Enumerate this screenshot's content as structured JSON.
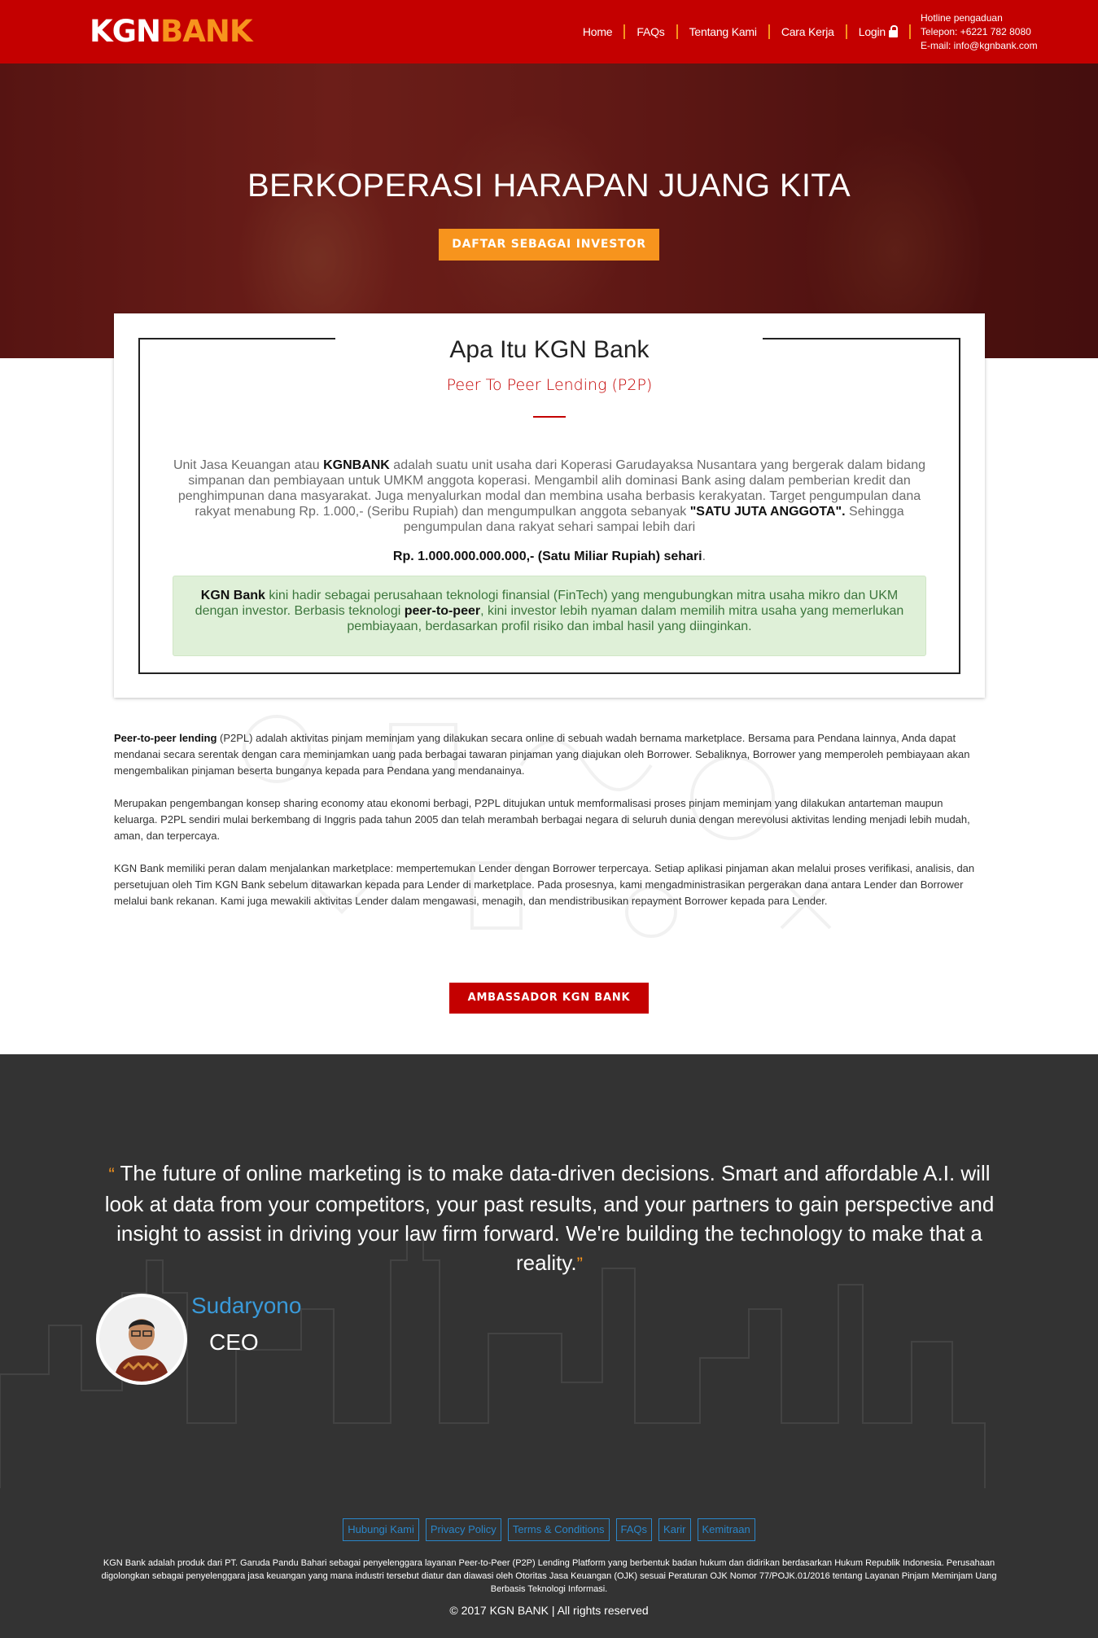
{
  "brand": {
    "logo_part1": "KGN",
    "logo_part2": "BANK"
  },
  "nav": {
    "items": [
      "Home",
      "FAQs",
      "Tentang Kami",
      "Cara Kerja",
      "Login"
    ]
  },
  "hotline": {
    "title": "Hotline pengaduan",
    "phone": "Telepon: +6221 782 8080",
    "email": "E-mail: info@kgnbank.com"
  },
  "hero": {
    "title": "BERKOPERASI HARAPAN JUANG KITA",
    "cta": "DAFTAR SEBAGAI INVESTOR"
  },
  "about": {
    "title": "Apa Itu KGN Bank",
    "subtitle": "Peer To Peer Lending (P2P)",
    "text_1": "Unit Jasa Keuangan atau ",
    "text_bold_1": "KGNBANK",
    "text_2": " adalah suatu unit usaha dari Koperasi Garudayaksa Nusantara yang bergerak dalam bidang simpanan dan pembiayaan untuk UMKM anggota koperasi. Mengambil alih dominasi Bank asing dalam pemberian kredit dan penghimpunan dana masyarakat. Juga menyalurkan modal dan membina usaha berbasis kerakyatan. Target pengumpulan dana rakyat menabung Rp. 1.000,- (Seribu Rupiah) dan mengumpulkan anggota sebanyak ",
    "text_bold_2": "\"SATU JUTA ANGGOTA\".",
    "text_3": " Sehingga pengumpulan dana rakyat sehari sampai lebih dari",
    "amount": "Rp. 1.000.000.000.000,- (Satu Miliar Rupiah) sehari",
    "amount_suffix": ".",
    "fintech_bold_1": "KGN Bank",
    "fintech_1": " kini hadir sebagai perusahaan teknologi finansial (FinTech) yang mengubungkan mitra usaha mikro dan UKM dengan investor. Berbasis teknologi ",
    "fintech_bold_2": "peer-to-peer",
    "fintech_2": ", kini investor lebih nyaman dalam memilih mitra usaha yang memerlukan pembiayaan, berdasarkan profil risiko dan imbal hasil yang diinginkan."
  },
  "body": {
    "p1_bold": "Peer-to-peer lending",
    "p1": " (P2PL) adalah aktivitas pinjam meminjam yang dilakukan secara online di sebuah wadah bernama marketplace. Bersama para Pendana lainnya, Anda dapat mendanai secara serentak dengan cara meminjamkan uang pada berbagai tawaran pinjaman yang diajukan oleh Borrower. Sebaliknya, Borrower yang memperoleh pembiayaan akan mengembalikan pinjaman beserta bunganya kepada para Pendana yang mendanainya.",
    "p2": "Merupakan pengembangan konsep sharing economy atau ekonomi berbagi, P2PL ditujukan untuk memformalisasi proses pinjam meminjam yang dilakukan antarteman maupun keluarga. P2PL sendiri mulai berkembang di Inggris pada tahun 2005 dan telah merambah berbagai negara di seluruh dunia dengan merevolusi aktivitas lending menjadi lebih mudah, aman, dan terpercaya.",
    "p3": "KGN Bank memiliki peran dalam menjalankan marketplace: mempertemukan Lender dengan Borrower terpercaya. Setiap aplikasi pinjaman akan melalui proses verifikasi, analisis, dan persetujuan oleh Tim KGN Bank sebelum ditawarkan kepada para Lender di marketplace. Pada prosesnya, kami mengadministrasikan pergerakan dana antara Lender dan Borrower melalui bank rekanan. Kami juga mewakili aktivitas Lender dalam mengawasi, menagih, dan mendistribusikan repayment Borrower kepada para Lender.",
    "ambassador": "AMBASSADOR KGN BANK"
  },
  "testimonial": {
    "open_quote": "“",
    "quote": " The future of online marketing is to make data-driven decisions. Smart and affordable A.I. will look at data from your competitors, your past results, and your partners to gain perspective and insight to assist in driving your law firm forward. We're building the technology to make that a reality.",
    "close_quote": "”",
    "name": "Sudaryono",
    "role": "CEO"
  },
  "footer": {
    "links": [
      "Hubungi Kami",
      "Privacy Policy",
      "Terms & Conditions",
      "FAQs",
      "Karir",
      "Kemitraan"
    ],
    "legal": "KGN Bank adalah produk dari PT. Garuda Pandu Bahari sebagai penyelenggara layanan Peer-to-Peer (P2P) Lending Platform yang berbentuk badan hukum dan didirikan berdasarkan Hukum Republik Indonesia. Perusahaan digolongkan sebagai penyelenggara jasa keuangan yang mana industri tersebut diatur dan diawasi oleh Otoritas Jasa Keuangan (OJK) sesuai Peraturan OJK Nomor 77/POJK.01/2016 tentang Layanan Pinjam Meminjam Uang Berbasis Teknologi Informasi.",
    "copyright": "© 2017 KGN BANK | All rights reserved"
  },
  "colors": {
    "brand_red": "#c40000",
    "accent_orange": "#f7941d",
    "link_blue": "#2a86c9",
    "dark_bg": "#333333"
  }
}
